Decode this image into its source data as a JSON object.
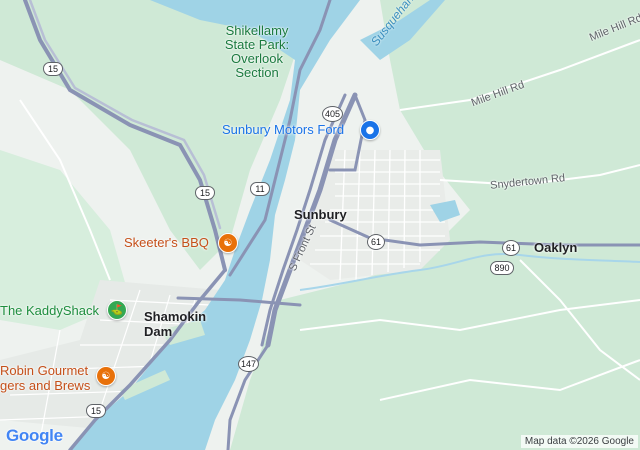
{
  "places": {
    "park_line1": "Shikellamy",
    "park_line2": "State Park:",
    "park_line3": "Overlook",
    "park_line4": "Section",
    "dealer": "Sunbury Motors Ford",
    "sunbury": "Sunbury",
    "bbq": "Skeeter's BBQ",
    "kaddyshack": "The KaddyShack",
    "shamokin_line1": "Shamokin",
    "shamokin_line2": "Dam",
    "robin_line1": "Robin Gourmet",
    "robin_line2": "gers and Brews",
    "oaklyn": "Oaklyn",
    "river": "Susquehanna River"
  },
  "roads": {
    "mile_hill_1": "Mile Hill Rd",
    "mile_hill_2": "Mile Hill Rd",
    "snydertown": "Snydertown Rd",
    "front_st": "S Front St"
  },
  "shields": {
    "us15_a": "15",
    "us15_b": "15",
    "us15_c": "15",
    "us11": "11",
    "pa405": "405",
    "pa61_a": "61",
    "pa61_b": "61",
    "pa890": "890",
    "pa147": "147"
  },
  "icons": {
    "park_icon": "golf-icon",
    "food_icon": "restaurant-icon",
    "dealer_icon": "car-dealer-icon"
  },
  "colors": {
    "water": "#9fd3e6",
    "land": "#e8eee9",
    "green": "#c6e8cf",
    "highway": "#8a93b4",
    "orange_poi": "#e8710a",
    "blue_poi": "#1a73e8",
    "green_poi": "#34a853"
  },
  "footer": {
    "logo": "Google",
    "attribution": "Map data ©2026 Google"
  }
}
